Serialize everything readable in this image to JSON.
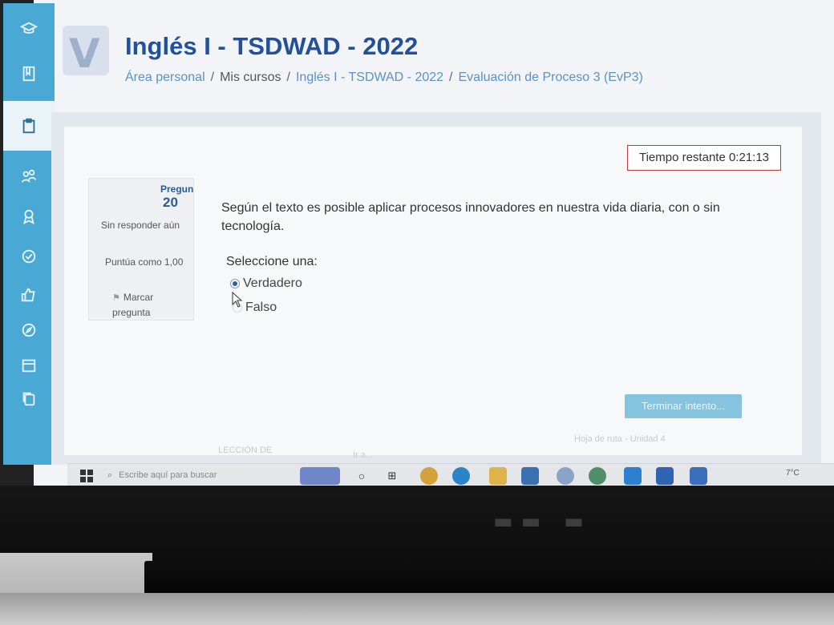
{
  "header": {
    "title": "Inglés I - TSDWAD - 2022",
    "breadcrumb": [
      {
        "label": "Área personal",
        "link": true
      },
      {
        "label": "Mis cursos",
        "link": false
      },
      {
        "label": "Inglés I - TSDWAD - 2022",
        "link": true
      },
      {
        "label": "Evaluación de Proceso 3 (EvP3)",
        "link": true
      }
    ],
    "separator": "/"
  },
  "sidebar": {
    "items": [
      {
        "icon": "graduation-cap-icon"
      },
      {
        "icon": "book-icon"
      },
      {
        "icon": "clipboard-icon",
        "active": true
      },
      {
        "icon": "users-icon"
      },
      {
        "icon": "award-icon"
      },
      {
        "icon": "check-circle-icon"
      },
      {
        "icon": "thumbs-up-icon"
      },
      {
        "icon": "compass-icon"
      },
      {
        "icon": "calendar-icon"
      },
      {
        "icon": "copy-icon"
      }
    ]
  },
  "quiz": {
    "timer": "Tiempo restante 0:21:13",
    "question_label": "Pregun",
    "question_number": "20",
    "status": "Sin responder aún",
    "score": "Puntúa como 1,00",
    "flag_label": "Marcar pregunta",
    "question_text": "Según el texto es posible aplicar procesos innovadores en nuestra vida diaria, con o sin tecnología.",
    "prompt": "Seleccione una:",
    "options": [
      {
        "label": "Verdadero",
        "selected": true
      },
      {
        "label": "Falso",
        "selected": false
      }
    ],
    "finish_button": "Terminar intento..."
  },
  "nav": {
    "prev_link": "LECCIÓN DE",
    "jump_to": "Ir a...",
    "next_link": "Hoja de ruta - Unidad 4"
  },
  "taskbar": {
    "search_placeholder": "Escribe aquí para buscar",
    "tray_text": "7°C"
  },
  "colors": {
    "sidebar": "#4aa8d4",
    "title": "#23509b",
    "link": "#5b91c6",
    "timer_border": "#c23a3a",
    "button": "#86c3df"
  }
}
